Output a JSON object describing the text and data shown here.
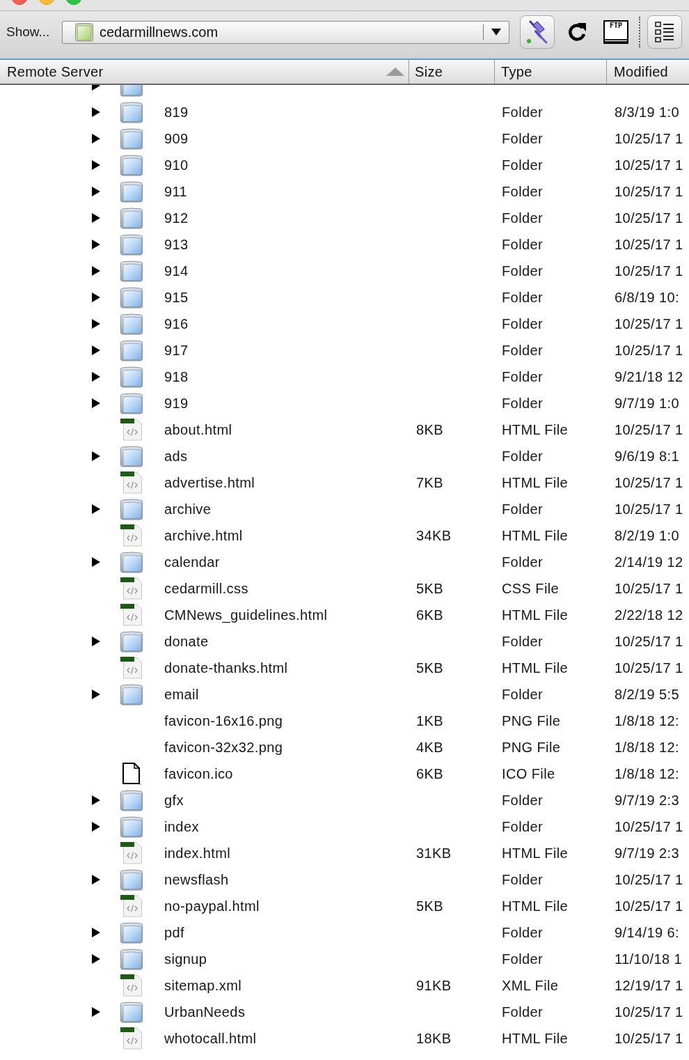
{
  "toolbar": {
    "show_label": "Show...",
    "site": "cedarmillnews.com",
    "buttons": [
      {
        "kind": "connect",
        "active": true
      },
      {
        "kind": "refresh",
        "active": false
      },
      {
        "kind": "ftp_log",
        "label": "FTP",
        "active": false
      },
      {
        "kind": "separator"
      },
      {
        "kind": "expand",
        "active": true
      }
    ]
  },
  "columns": [
    {
      "label": "Remote Server",
      "sorted": true
    },
    {
      "label": "Size",
      "sorted": false
    },
    {
      "label": "Type",
      "sorted": false
    },
    {
      "label": "Modified",
      "sorted": false
    }
  ],
  "rows": [
    {
      "kind": "folder",
      "expanded": false
    },
    {
      "kind": "folder",
      "expanded": false,
      "name": "819",
      "type": "Folder",
      "modified": "8/3/19 1:0"
    },
    {
      "kind": "folder",
      "expanded": false,
      "name": "909",
      "type": "Folder",
      "modified": "10/25/17 1"
    },
    {
      "kind": "folder",
      "expanded": false,
      "name": "910",
      "type": "Folder",
      "modified": "10/25/17 1"
    },
    {
      "kind": "folder",
      "expanded": false,
      "name": "911",
      "type": "Folder",
      "modified": "10/25/17 1"
    },
    {
      "kind": "folder",
      "expanded": false,
      "name": "912",
      "type": "Folder",
      "modified": "10/25/17 1"
    },
    {
      "kind": "folder",
      "expanded": false,
      "name": "913",
      "type": "Folder",
      "modified": "10/25/17 1"
    },
    {
      "kind": "folder",
      "expanded": false,
      "name": "914",
      "type": "Folder",
      "modified": "10/25/17 1"
    },
    {
      "kind": "folder",
      "expanded": false,
      "name": "915",
      "type": "Folder",
      "modified": "6/8/19 10:"
    },
    {
      "kind": "folder",
      "expanded": false,
      "name": "916",
      "type": "Folder",
      "modified": "10/25/17 1"
    },
    {
      "kind": "folder",
      "expanded": false,
      "name": "917",
      "type": "Folder",
      "modified": "10/25/17 1"
    },
    {
      "kind": "folder",
      "expanded": false,
      "name": "918",
      "type": "Folder",
      "modified": "9/21/18 12"
    },
    {
      "kind": "folder",
      "expanded": false,
      "name": "919",
      "type": "Folder",
      "modified": "9/7/19 1:0"
    },
    {
      "kind": "code_file",
      "name": "about.html",
      "size": "8KB",
      "type": "HTML File",
      "modified": "10/25/17 1"
    },
    {
      "kind": "folder",
      "expanded": false,
      "name": "ads",
      "type": "Folder",
      "modified": "9/6/19 8:1"
    },
    {
      "kind": "code_file",
      "name": "advertise.html",
      "size": "7KB",
      "type": "HTML File",
      "modified": "10/25/17 1"
    },
    {
      "kind": "folder",
      "expanded": false,
      "name": "archive",
      "type": "Folder",
      "modified": "10/25/17 1"
    },
    {
      "kind": "code_file",
      "name": "archive.html",
      "size": "34KB",
      "type": "HTML File",
      "modified": "8/2/19 1:0"
    },
    {
      "kind": "folder",
      "expanded": false,
      "name": "calendar",
      "type": "Folder",
      "modified": "2/14/19 12"
    },
    {
      "kind": "code_file",
      "name": "cedarmill.css",
      "size": "5KB",
      "type": "CSS File",
      "modified": "10/25/17 1"
    },
    {
      "kind": "code_file",
      "name": "CMNews_guidelines.html",
      "size": "6KB",
      "type": "HTML File",
      "modified": "2/22/18 12"
    },
    {
      "kind": "folder",
      "expanded": false,
      "name": "donate",
      "type": "Folder",
      "modified": "10/25/17 1"
    },
    {
      "kind": "code_file",
      "name": "donate-thanks.html",
      "size": "5KB",
      "type": "HTML File",
      "modified": "10/25/17 1"
    },
    {
      "kind": "folder",
      "expanded": false,
      "name": "email",
      "type": "Folder",
      "modified": "8/2/19 5:5"
    },
    {
      "kind": "image_file",
      "name": "favicon-16x16.png",
      "size": "1KB",
      "type": "PNG File",
      "modified": "1/8/18 12:"
    },
    {
      "kind": "image_file",
      "name": "favicon-32x32.png",
      "size": "4KB",
      "type": "PNG File",
      "modified": "1/8/18 12:"
    },
    {
      "kind": "plain_file",
      "name": "favicon.ico",
      "size": "6KB",
      "type": "ICO File",
      "modified": "1/8/18 12:"
    },
    {
      "kind": "folder",
      "expanded": false,
      "name": "gfx",
      "type": "Folder",
      "modified": "9/7/19 2:3"
    },
    {
      "kind": "folder",
      "expanded": false,
      "name": "index",
      "type": "Folder",
      "modified": "10/25/17 1"
    },
    {
      "kind": "code_file",
      "name": "index.html",
      "size": "31KB",
      "type": "HTML File",
      "modified": "9/7/19 2:3"
    },
    {
      "kind": "folder",
      "expanded": false,
      "name": "newsflash",
      "type": "Folder",
      "modified": "10/25/17 1"
    },
    {
      "kind": "code_file",
      "name": "no-paypal.html",
      "size": "5KB",
      "type": "HTML File",
      "modified": "10/25/17 1"
    },
    {
      "kind": "folder",
      "expanded": false,
      "name": "pdf",
      "type": "Folder",
      "modified": "9/14/19 6:"
    },
    {
      "kind": "folder",
      "expanded": false,
      "name": "signup",
      "type": "Folder",
      "modified": "11/10/18 1"
    },
    {
      "kind": "code_file",
      "name": "sitemap.xml",
      "size": "91KB",
      "type": "XML File",
      "modified": "12/19/17 1"
    },
    {
      "kind": "folder",
      "expanded": false,
      "name": "UrbanNeeds",
      "type": "Folder",
      "modified": "10/25/17 1"
    },
    {
      "kind": "code_file",
      "name": "whotocall.html",
      "size": "18KB",
      "type": "HTML File",
      "modified": "10/25/17 1"
    }
  ]
}
